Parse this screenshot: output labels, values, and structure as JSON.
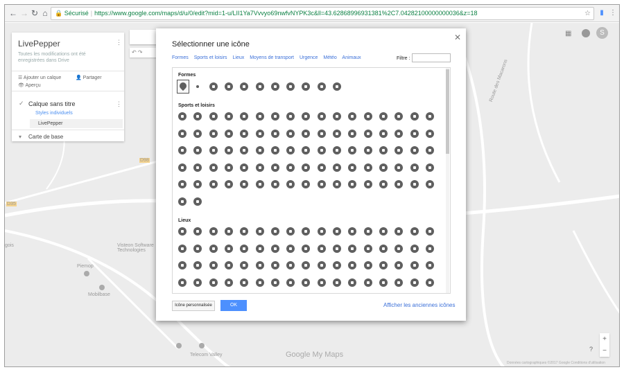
{
  "browser": {
    "secure_label": "Sécurisé",
    "url": "https://www.google.com/maps/d/u/0/edit?mid=1-u/LII1Ya7Vvvyo69nwfvNYPK3c&ll=43.62868996931381%2C7.04282100000000036&z=18"
  },
  "panel": {
    "title": "LivePepper",
    "subtitle": "Toutes les modifications ont été enregistrées dans Drive",
    "add_layer": "Ajouter un calque",
    "share": "Partager",
    "preview": "Aperçu",
    "layer_title": "Calque sans titre",
    "styles": "Styles individuels",
    "item": "LivePepper",
    "base_map": "Carte de base"
  },
  "map": {
    "labels": [
      {
        "text": "Route des Macarons"
      },
      {
        "text": "Visteon Software Technologies"
      },
      {
        "text": "Piemop"
      },
      {
        "text": "Mobilbase"
      },
      {
        "text": "Telecom Valley"
      },
      {
        "text": "gois"
      },
      {
        "text": "D35"
      },
      {
        "text": "D98"
      }
    ],
    "logo": "Google My Maps",
    "footer": "Données cartographiques ©2017 Google   Conditions d'utilisation"
  },
  "dialog": {
    "title": "Sélectionner une icône",
    "categories": [
      "Formes",
      "Sports et loisirs",
      "Lieux",
      "Moyens de transport",
      "Urgence",
      "Météo",
      "Animaux"
    ],
    "filter_label": "Filtre :",
    "filter_value": "",
    "sections": {
      "shapes": "Formes",
      "sports": "Sports et loisirs",
      "places": "Lieux"
    },
    "custom_button": "Icône personnalisée",
    "ok_button": "OK",
    "old_icons_link": "Afficher les anciennes icônes"
  },
  "icons": {
    "shapes": [
      "pin-icon",
      "small-dot-icon",
      "circle-icon",
      "square-icon",
      "diamond-icon",
      "ring-icon",
      "star-icon",
      "heart-icon",
      "quote-icon",
      "check-icon",
      "cross-icon"
    ],
    "sports_rows": [
      17,
      17,
      17,
      17,
      17,
      2
    ],
    "places_rows": [
      17,
      17,
      17,
      17
    ]
  },
  "colors": {
    "accent": "#4d90fe",
    "link": "#3a6fd8",
    "icon": "#5f5f5f",
    "secure": "#0b8043"
  }
}
